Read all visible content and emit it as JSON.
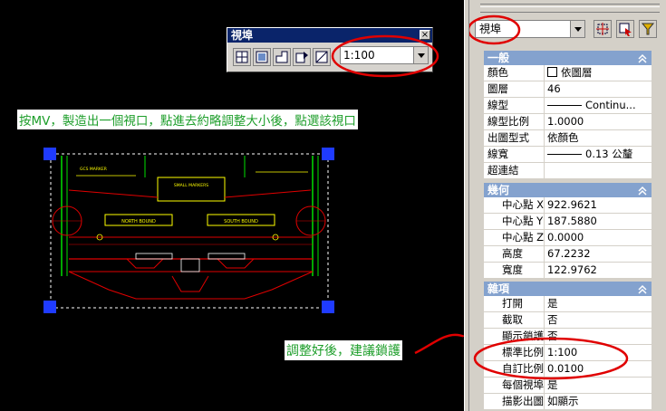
{
  "viewport_toolbar": {
    "title": "視埠",
    "close": "×",
    "scale_value": "1:100"
  },
  "drawing_labels": {
    "gcs_marker": "GCS MARKER",
    "small_markers": "SMALL MARKERS",
    "north_bound": "NORTH BOUND",
    "south_bound": "SOUTH BOUND"
  },
  "annotations": {
    "instruction": "按MV，製造出一個視口，點進去約略調整大小後，點選該視口",
    "lock_tip": "調整好後，建議鎖護"
  },
  "properties": {
    "object_type": "視埠",
    "sections": {
      "general": {
        "title": "一般",
        "rows": [
          {
            "name": "顏色",
            "value": "依圖層"
          },
          {
            "name": "圖層",
            "value": "46"
          },
          {
            "name": "線型",
            "value": "Continu..."
          },
          {
            "name": "線型比例",
            "value": "1.0000"
          },
          {
            "name": "出圖型式",
            "value": "依顏色"
          },
          {
            "name": "線寬",
            "value": "0.13 公釐"
          },
          {
            "name": "超連結",
            "value": ""
          }
        ]
      },
      "geometry": {
        "title": "幾何",
        "rows": [
          {
            "name": "中心點 X",
            "value": "922.9621"
          },
          {
            "name": "中心點 Y",
            "value": "187.5880"
          },
          {
            "name": "中心點 Z",
            "value": "0.0000"
          },
          {
            "name": "高度",
            "value": "67.2232"
          },
          {
            "name": "寬度",
            "value": "122.9762"
          }
        ]
      },
      "misc": {
        "title": "雜項",
        "rows": [
          {
            "name": "打開",
            "value": "是"
          },
          {
            "name": "截取",
            "value": "否"
          },
          {
            "name": "顯示鎖護",
            "value": "否"
          },
          {
            "name": "標準比例",
            "value": "1:100"
          },
          {
            "name": "自訂比例",
            "value": "0.0100"
          },
          {
            "name": "每個視埠...",
            "value": "是"
          },
          {
            "name": "描影出圖",
            "value": "如顯示"
          }
        ]
      }
    }
  },
  "colors": {
    "canvas": "#000000",
    "highlight_ellipse": "#e00000",
    "grip": "#1f3bff",
    "section_header": "#84a2ce",
    "note_text": "#1d9e2a"
  }
}
